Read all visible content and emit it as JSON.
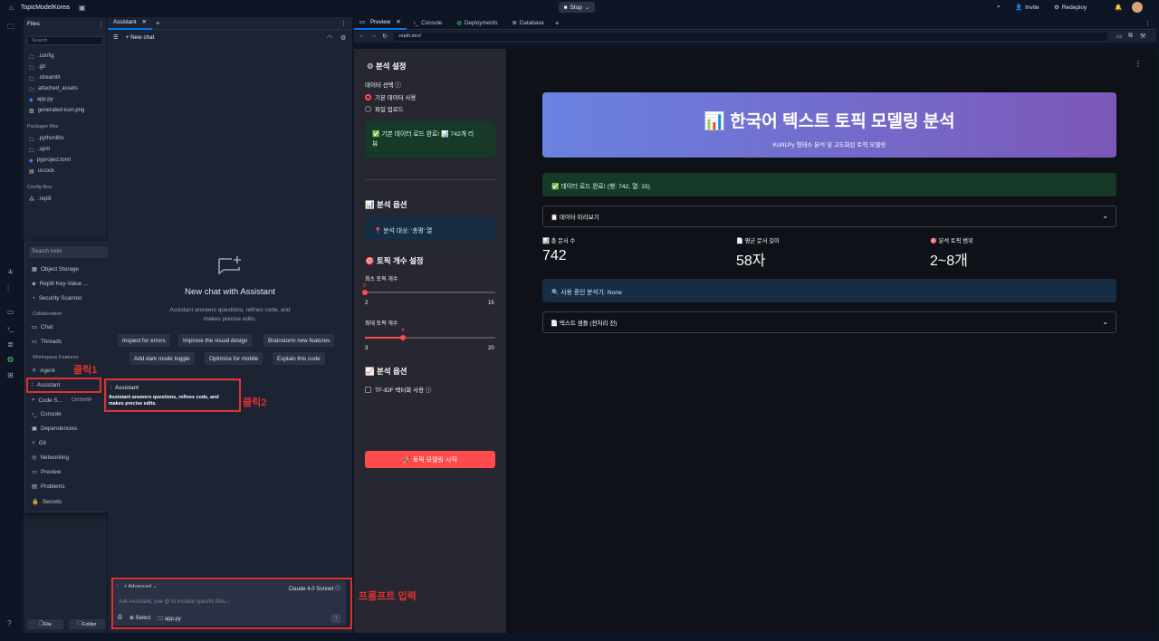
{
  "topbar": {
    "project_name": "TopicModelKorea",
    "stop_label": "Stop",
    "invite_label": "Invite",
    "redeploy_label": "Redeploy"
  },
  "files": {
    "title": "Files",
    "search_placeholder": "Search",
    "items": [
      ".config",
      ".git",
      ".streamlit",
      "attached_assets",
      "app.py",
      "generated-icon.png"
    ],
    "packager_title": "Packager files",
    "packager_items": [
      ".pythonlibs",
      ".upm",
      "pyproject.toml",
      "uv.lock"
    ],
    "config_title": "Config files",
    "config_items": [
      ".replit"
    ],
    "file_btn": "File",
    "folder_btn": "Folder"
  },
  "tools": {
    "search_placeholder": "Search tools",
    "group1": [
      "Object Storage",
      "Replit Key-Value ...",
      "Security Scanner"
    ],
    "collab_title": "Collaboration",
    "collab": [
      "Chat",
      "Threads"
    ],
    "workspace_title": "Workspace Features",
    "workspace": [
      "Agent",
      "Assistant",
      "Code S...",
      "Console",
      "Dependencies",
      "Git",
      "Networking",
      "Preview",
      "Problems",
      "Secrets"
    ],
    "shortcut": "CtrlShiftF"
  },
  "tooltip": {
    "title": "Assistant",
    "desc": "Assistant answers questions, refines code, and makes precise edits."
  },
  "assistant": {
    "tab": "Assistant",
    "new_chat": "New chat",
    "title": "New chat with Assistant",
    "desc_line1": "Assistant answers questions, refines code, and",
    "desc_line2": "makes precise edits.",
    "suggestions": [
      "Inspect for errors",
      "Improve the visual design",
      "Brainstorm new features",
      "Add dark mode toggle",
      "Optimize for mobile",
      "Explain this code"
    ],
    "mode": "Advanced",
    "model": "Claude 4.0 Sonnet",
    "placeholder": "Ask Assistant, use @ to include specific files...",
    "select_label": "Select",
    "file_label": "app.py"
  },
  "preview": {
    "tabs": [
      "Preview",
      "Console",
      "Deployments",
      "Database"
    ],
    "url": ".replit.dev/"
  },
  "sidebar": {
    "analysis_settings": "분석 설정",
    "data_select": "데이터 선택",
    "radio_default": "기본 데이터 사용",
    "radio_upload": "파일 업로드",
    "load_done_1": "✅ 기본 데이터 로드 완료! 📊 742개 리",
    "load_done_2": "뷰",
    "analysis_options": "분석 옵션",
    "target": "📍 분석 대상: '총평' 열",
    "topic_count": "토픽 개수 설정",
    "min_label": "최소 토픽 개수",
    "min_value": "2",
    "min_lo": "2",
    "min_hi": "15",
    "max_label": "최대 토픽 개수",
    "max_value": "8",
    "max_lo": "3",
    "max_hi": "20",
    "analysis_options2": "분석 옵션",
    "tfidf": "TF-IDF 벡터화 사용",
    "run": "🚀 토픽 모델링 시작"
  },
  "main": {
    "title": "한국어 텍스트 토픽 모델링 분석",
    "subtitle": "KoNLPy 형태소 분석 및 고도화된 토픽 모델링",
    "loaded": "✅ 데이터 로드 완료! (행: 742, 열: 15)",
    "preview_exp": "📋 데이터 미리보기",
    "m1_label": "📊 총 문서 수",
    "m1_val": "742",
    "m2_label": "📄 평균 문서 길이",
    "m2_val": "58자",
    "m3_label": "🎯 분석 토픽 범위",
    "m3_val": "2~8개",
    "analyzer": "🔍 사용 중인 분석기: None",
    "sample_exp": "📄 텍스트 샘플 (전처리 전)"
  },
  "annotations": {
    "click1": "클릭1",
    "click2": "클릭2",
    "prompt": "프롬프트 입력"
  },
  "slider_values": {
    "min_fraction": 0.0,
    "max_fraction": 0.294
  },
  "colors": {
    "accent": "#ff4b4b",
    "annotation": "#e03131",
    "brand_blue": "#0079f2"
  }
}
